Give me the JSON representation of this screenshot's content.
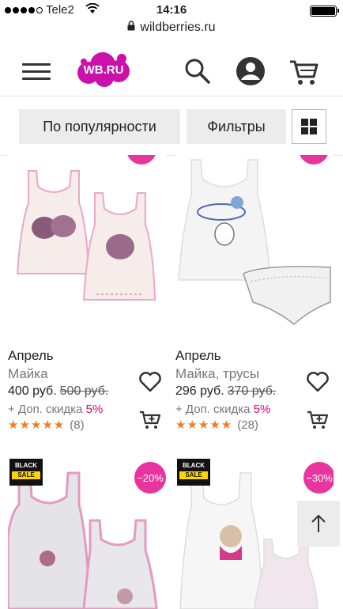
{
  "status": {
    "carrier": "Tele2",
    "time": "14:16"
  },
  "browser": {
    "url": "wildberries.ru"
  },
  "header": {
    "logo_text": "WB.RU",
    "brand_color": "#cb11ab"
  },
  "toolbar": {
    "sort_label": "По популярности",
    "filter_label": "Фильтры"
  },
  "products": [
    {
      "brand": "Апрель",
      "name": "Майка",
      "price": "400 руб.",
      "old_price": "500 руб.",
      "extra_prefix": "+ Доп. скидка",
      "extra_pct": "5%",
      "stars": "★★★★★",
      "reviews": "(8)"
    },
    {
      "brand": "Апрель",
      "name": "Майка, трусы",
      "price": "296 руб.",
      "old_price": "370 руб.",
      "extra_prefix": "+ Доп. скидка",
      "extra_pct": "5%",
      "stars": "★★★★★",
      "reviews": "(28)"
    },
    {
      "sale_top": "BLACK",
      "sale_bottom": "SALE",
      "discount": "−20%"
    },
    {
      "sale_top": "BLACK",
      "sale_bottom": "SALE",
      "discount": "−30%"
    }
  ],
  "colors": {
    "accent_pink": "#e8349e",
    "star_orange": "#f57b20"
  }
}
